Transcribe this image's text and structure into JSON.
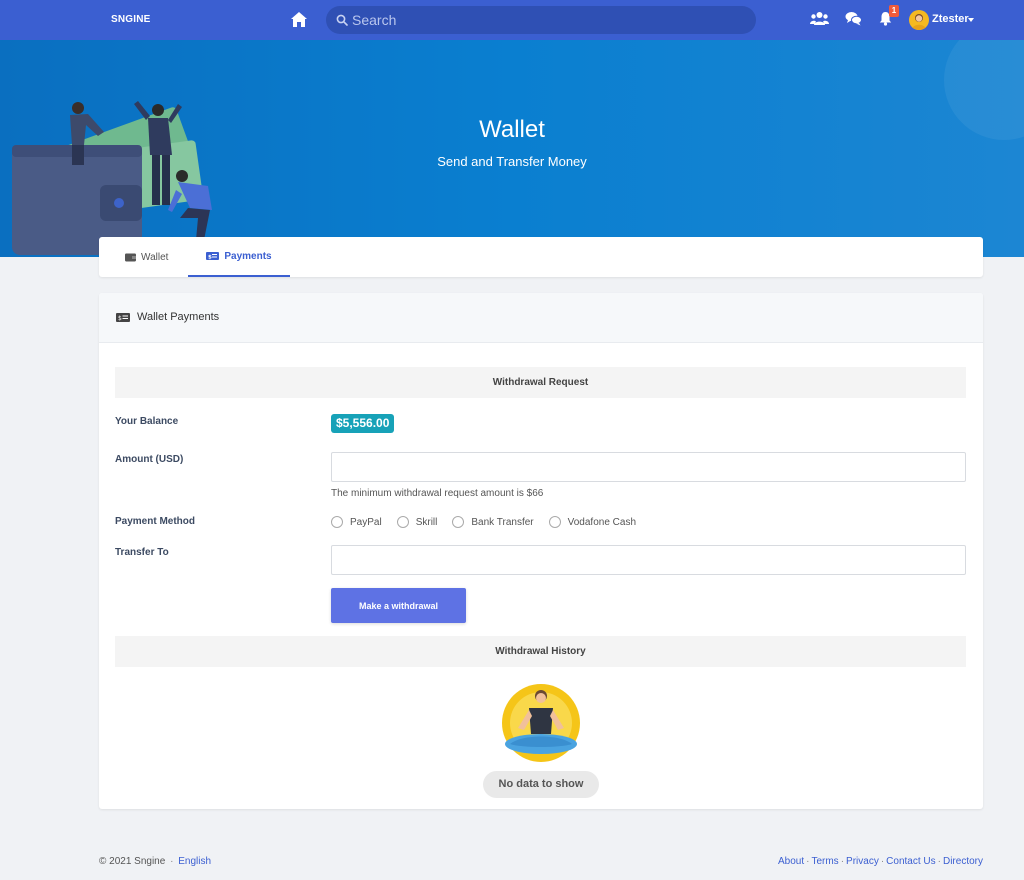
{
  "navbar": {
    "logo": "SNGINE",
    "search_placeholder": "Search",
    "notification_count": "1",
    "username": "Ztester"
  },
  "hero": {
    "title": "Wallet",
    "subtitle": "Send and Transfer Money"
  },
  "tabs": [
    {
      "label": "Wallet",
      "icon": "wallet-icon"
    },
    {
      "label": "Payments",
      "icon": "money-icon",
      "active": true
    }
  ],
  "card": {
    "title": "Wallet Payments",
    "withdrawal_section": "Withdrawal Request",
    "balance_label": "Your Balance",
    "balance_value": "$5,556.00",
    "amount_label": "Amount (USD)",
    "amount_value": "",
    "amount_help": "The minimum withdrawal request amount is $66",
    "method_label": "Payment Method",
    "methods": [
      "PayPal",
      "Skrill",
      "Bank Transfer",
      "Vodafone Cash"
    ],
    "transfer_label": "Transfer To",
    "transfer_value": "",
    "submit_label": "Make a withdrawal",
    "history_section": "Withdrawal History",
    "empty_text": "No data to show"
  },
  "footer": {
    "copyright": "© 2021 Sngine",
    "language": "English",
    "links": [
      "About",
      "Terms",
      "Privacy",
      "Contact Us",
      "Directory"
    ]
  },
  "colors": {
    "navbar": "#3b5fd1",
    "hero": "#0a7fd0",
    "balance_badge": "#17a2b8",
    "primary_button": "#5e72e4"
  }
}
